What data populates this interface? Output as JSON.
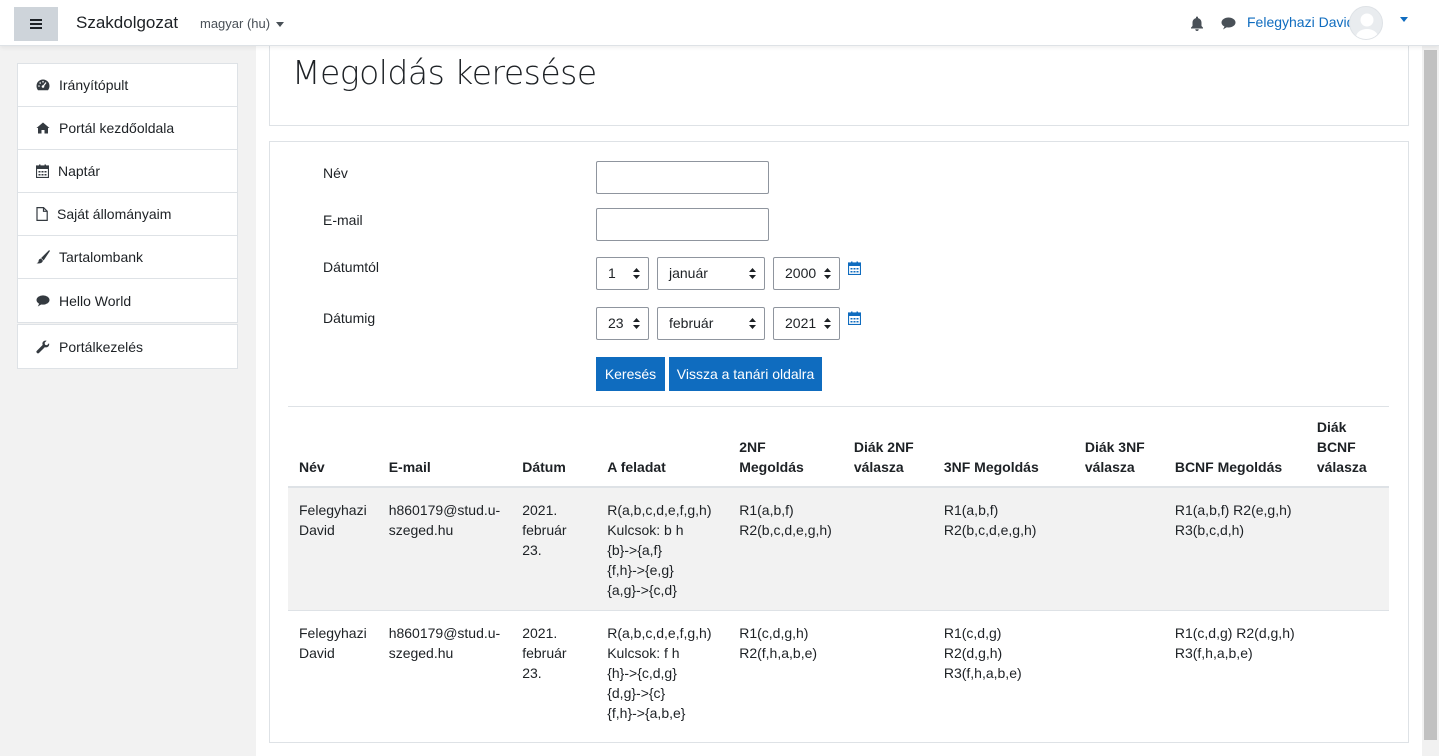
{
  "navbar": {
    "brand": "Szakdolgozat",
    "language": "magyar (hu)",
    "username": "Felegyhazi David"
  },
  "sidebar": {
    "items": [
      {
        "label": "Irányítópult",
        "icon": "dashboard-icon"
      },
      {
        "label": "Portál kezdőoldala",
        "icon": "home-icon"
      },
      {
        "label": "Naptár",
        "icon": "calendar-icon"
      },
      {
        "label": "Saját állományaim",
        "icon": "file-icon"
      },
      {
        "label": "Tartalombank",
        "icon": "brush-icon"
      },
      {
        "label": "Hello World",
        "icon": "comment-icon"
      }
    ],
    "admin": {
      "label": "Portálkezelés",
      "icon": "wrench-icon"
    }
  },
  "page": {
    "title": "Megoldás keresése"
  },
  "form": {
    "name_label": "Név",
    "name_value": "",
    "email_label": "E-mail",
    "email_value": "",
    "from_label": "Dátumtól",
    "from_day": "1",
    "from_month": "január",
    "from_year": "2000",
    "to_label": "Dátumig",
    "to_day": "23",
    "to_month": "február",
    "to_year": "2021",
    "search_button": "Keresés",
    "back_button": "Vissza a tanári oldalra"
  },
  "table": {
    "headers": [
      "Név",
      "E-mail",
      "Dátum",
      "A feladat",
      "2NF Megoldás",
      "Diák 2NF válasza",
      "3NF Megoldás",
      "Diák 3NF válasza",
      "BCNF Megoldás",
      "Diák BCNF válasza"
    ],
    "rows": [
      [
        "Felegyhazi David",
        "h860179@stud.u-szeged.hu",
        "2021. február 23.",
        "R(a,b,c,d,e,f,g,h)\nKulcsok: b h\n{b}->{a,f}\n{f,h}->{e,g}\n{a,g}->{c,d}",
        "R1(a,b,f)\nR2(b,c,d,e,g,h)",
        "",
        "R1(a,b,f)\nR2(b,c,d,e,g,h)",
        "",
        "R1(a,b,f) R2(e,g,h)\nR3(b,c,d,h)",
        ""
      ],
      [
        "Felegyhazi David",
        "h860179@stud.u-szeged.hu",
        "2021. február 23.",
        "R(a,b,c,d,e,f,g,h)\nKulcsok: f h\n{h}->{c,d,g}\n{d,g}->{c}\n{f,h}->{a,b,e}",
        "R1(c,d,g,h)\nR2(f,h,a,b,e)",
        "",
        "R1(c,d,g) R2(d,g,h)\nR3(f,h,a,b,e)",
        "",
        "R1(c,d,g) R2(d,g,h)\nR3(f,h,a,b,e)",
        ""
      ]
    ]
  },
  "colors": {
    "primary": "#0f6cbf",
    "stripe": "#f2f2f2"
  }
}
